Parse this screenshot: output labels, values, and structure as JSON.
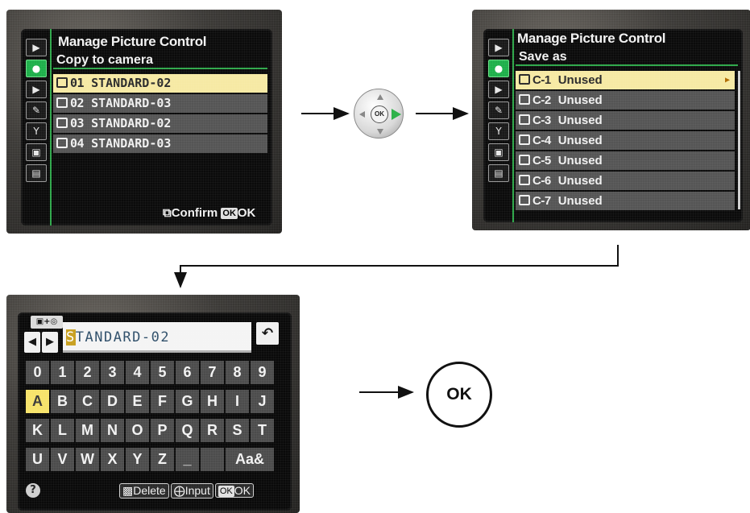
{
  "screen1": {
    "title": "Manage Picture Control",
    "subtitle": "Copy to camera",
    "tabs": [
      "play-icon",
      "camera-icon",
      "movie-icon",
      "pencil-icon",
      "wrench-icon",
      "retouch-icon",
      "mymenu-icon"
    ],
    "rows": [
      {
        "num": "01",
        "text": "STANDARD-02"
      },
      {
        "num": "02",
        "text": "STANDARD-03"
      },
      {
        "num": "03",
        "text": "STANDARD-02"
      },
      {
        "num": "04",
        "text": "STANDARD-03"
      }
    ],
    "footer": {
      "confirm": "Confirm",
      "ok_badge": "OK",
      "ok": "OK"
    }
  },
  "screen2": {
    "title": "Manage Picture Control",
    "subtitle": "Save as",
    "rows": [
      {
        "num": "C-1",
        "text": "Unused"
      },
      {
        "num": "C-2",
        "text": "Unused"
      },
      {
        "num": "C-3",
        "text": "Unused"
      },
      {
        "num": "C-4",
        "text": "Unused"
      },
      {
        "num": "C-5",
        "text": "Unused"
      },
      {
        "num": "C-6",
        "text": "Unused"
      },
      {
        "num": "C-7",
        "text": "Unused"
      }
    ]
  },
  "screen3": {
    "entry_first": "S",
    "entry_rest": "TANDARD-02",
    "key_rows": [
      [
        "0",
        "1",
        "2",
        "3",
        "4",
        "5",
        "6",
        "7",
        "8",
        "9"
      ],
      [
        "A",
        "B",
        "C",
        "D",
        "E",
        "F",
        "G",
        "H",
        "I",
        "J"
      ],
      [
        "K",
        "L",
        "M",
        "N",
        "O",
        "P",
        "Q",
        "R",
        "S",
        "T"
      ],
      [
        "U",
        "V",
        "W",
        "X",
        "Y",
        "Z",
        "_"
      ]
    ],
    "symbol_key": "Aa&",
    "footer": {
      "delete": "Delete",
      "input": "Input",
      "ok_badge": "OK",
      "ok": "OK"
    },
    "help": "?"
  },
  "dial": {
    "center": "OK"
  },
  "ok_button": "OK"
}
